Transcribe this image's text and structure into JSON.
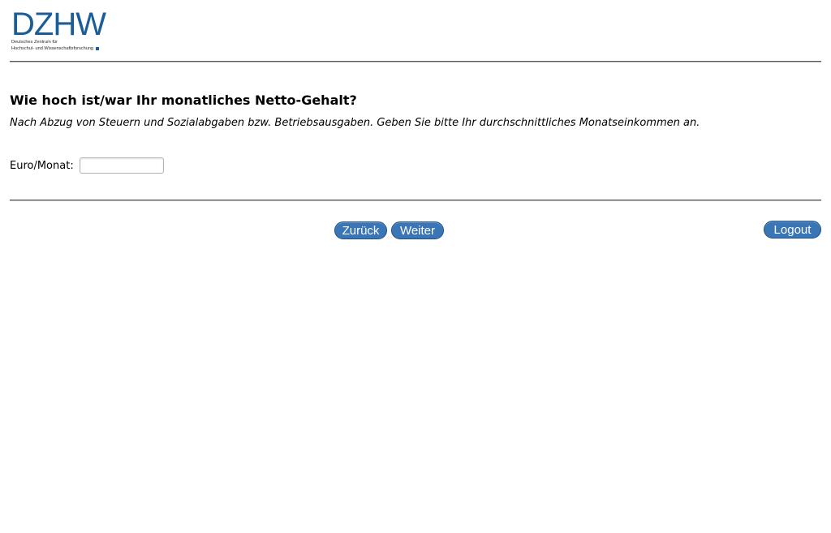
{
  "header": {
    "logo_text": "DZHW",
    "logo_subtitle_line1": "Deutsches Zentrum für",
    "logo_subtitle_line2": "Hochschul- und Wissenschaftsforschung",
    "brand_color": "#1a5d99"
  },
  "question": {
    "title": "Wie hoch ist/war Ihr monatliches Netto-Gehalt?",
    "hint": "Nach Abzug von Steuern und Sozialabgaben bzw. Betriebsausgaben. Geben Sie bitte Ihr durchschnittliches Monatseinkommen an."
  },
  "form": {
    "income_label": "Euro/Monat:",
    "income_value": ""
  },
  "navigation": {
    "back_label": "Zurück",
    "next_label": "Weiter",
    "logout_label": "Logout",
    "button_color": "#3a76b5"
  }
}
